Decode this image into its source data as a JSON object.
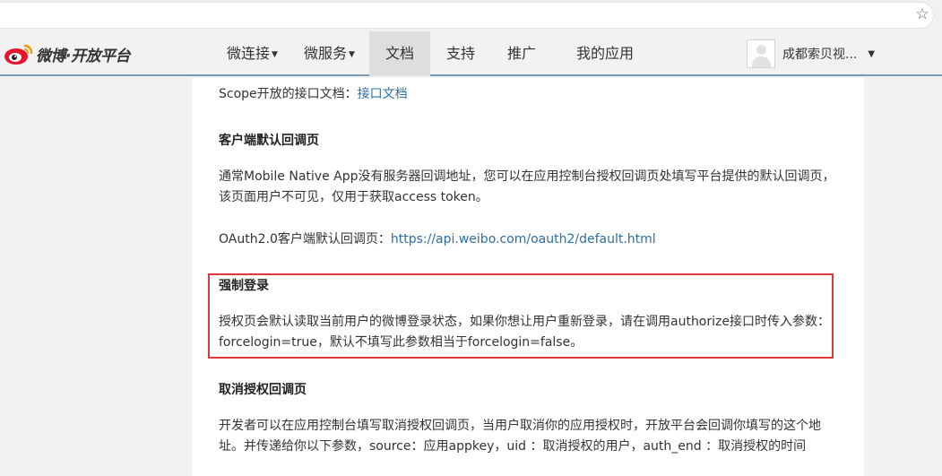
{
  "nav": {
    "items": [
      {
        "label": "微连接",
        "has_caret": true
      },
      {
        "label": "微服务",
        "has_caret": true
      },
      {
        "label": "文档",
        "active": true
      },
      {
        "label": "支持"
      },
      {
        "label": "推广"
      },
      {
        "label": "我的应用"
      }
    ]
  },
  "logo": {
    "text": "微博·开放平台",
    "icon": "weibo-logo-icon"
  },
  "user": {
    "name": "成都索贝视...",
    "avatar_icon": "avatar-placeholder-icon"
  },
  "browser": {
    "bookmark_icon": "star-icon"
  },
  "doc": {
    "scope_label": "Scope开放的接口文档：",
    "scope_link": "接口文档",
    "sec1_title": "客户端默认回调页",
    "sec1_para": "通常Mobile Native App没有服务器回调地址，您可以在应用控制台授权回调页处填写平台提供的默认回调页，该页面用户不可见，仅用于获取access token。",
    "sec1_url_label": "OAuth2.0客户端默认回调页：",
    "sec1_url": "https://api.weibo.com/oauth2/default.html",
    "sec2_title": "强制登录",
    "sec2_para": "授权页会默认读取当前用户的微博登录状态，如果你想让用户重新登录，请在调用authorize接口时传入参数：forcelogin=true，默认不填写此参数相当于forcelogin=false。",
    "sec3_title": "取消授权回调页",
    "sec3_para": "开发者可以在应用控制台填写取消授权回调页，当用户取消你的应用授权时，开放平台会回调你填写的这个地址。并传递给你以下参数，source：应用appkey，uid ：取消授权的用户，auth_end ：取消授权的时间"
  },
  "colors": {
    "link": "#2d6ea8",
    "highlight_border": "#e0373a",
    "header_border": "#7a9ab4"
  }
}
